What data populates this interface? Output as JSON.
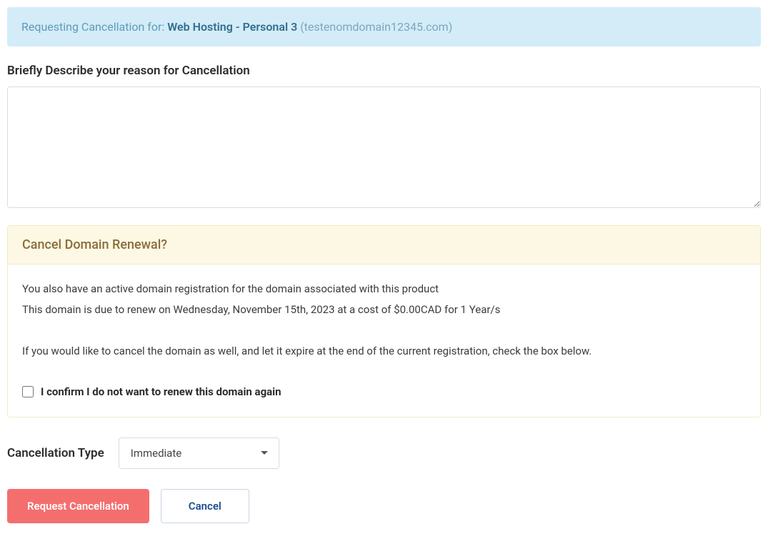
{
  "banner": {
    "prefix": "Requesting Cancellation for: ",
    "product": "Web Hosting - Personal 3 ",
    "domain": "(testenomdomain12345.com)"
  },
  "reason": {
    "label": "Briefly Describe your reason for Cancellation",
    "value": ""
  },
  "domainPanel": {
    "title": "Cancel Domain Renewal?",
    "line1": "You also have an active domain registration for the domain associated with this product",
    "line2": "This domain is due to renew on Wednesday, November 15th, 2023 at a cost of $0.00CAD for 1 Year/s",
    "line3": "If you would like to cancel the domain as well, and let it expire at the end of the current registration, check the box below.",
    "checkboxLabel": "I confirm I do not want to renew this domain again"
  },
  "cancellationType": {
    "label": "Cancellation Type",
    "selected": "Immediate"
  },
  "buttons": {
    "submit": "Request Cancellation",
    "cancel": "Cancel"
  }
}
